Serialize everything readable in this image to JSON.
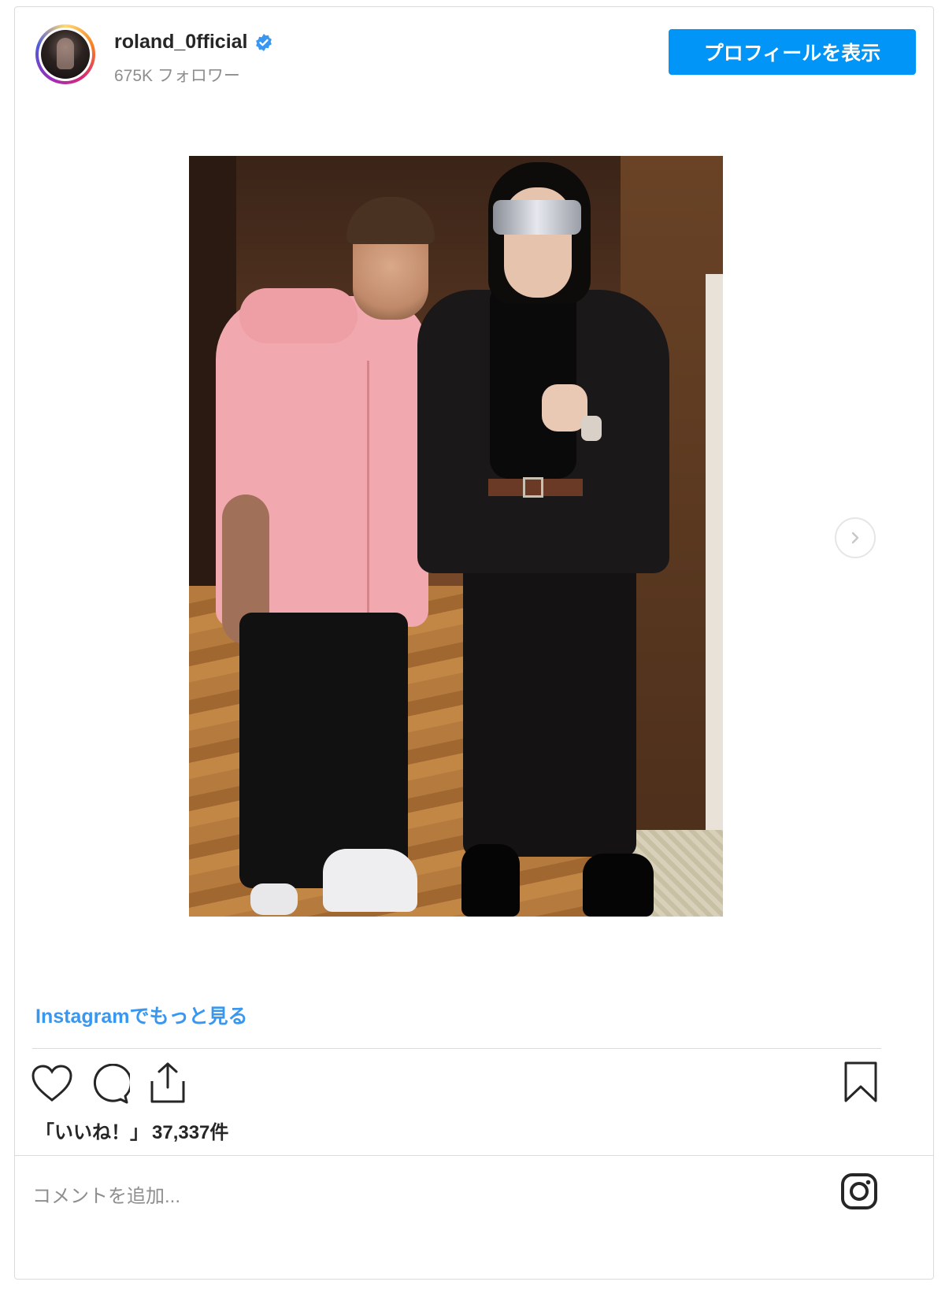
{
  "header": {
    "username": "roland_0fficial",
    "followers": "675K フォロワー",
    "profile_button": "プロフィールを表示"
  },
  "post": {
    "more_link": "Instagramでもっと見る",
    "likes_prefix": "「いいね！」",
    "likes_count": "37,337件"
  },
  "comment": {
    "placeholder": "コメントを追加..."
  },
  "icons": {
    "verified": "verified-badge-icon",
    "next": "chevron-right-icon",
    "like": "heart-icon",
    "comment": "comment-icon",
    "share": "share-icon",
    "save": "bookmark-icon",
    "instagram": "instagram-logo-icon"
  },
  "colors": {
    "accent": "#0095f6",
    "link": "#3897f0",
    "text": "#262626",
    "muted": "#8e8e8e",
    "border": "#dbdbdb"
  }
}
